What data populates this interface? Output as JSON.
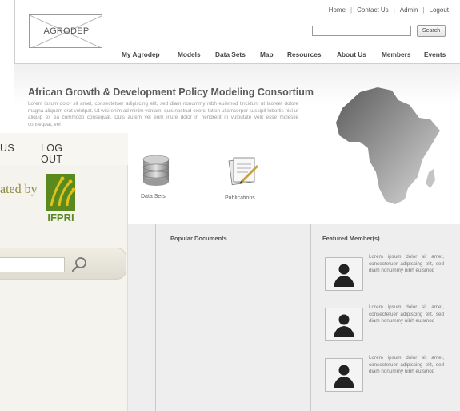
{
  "wire": {
    "logo_text": "AGRODEP",
    "top_links": [
      "Home",
      "Contact Us",
      "Admin",
      "Logout"
    ],
    "search_button": "Search",
    "nav": [
      "My Agrodep",
      "Models",
      "Data Sets",
      "Map",
      "Resources",
      "About Us",
      "Members",
      "Events"
    ],
    "hero_title": "African Growth & Development Policy Modeling Consortium",
    "hero_text": "Lorem ipsum dolor sit amet, consectetuer adipiscing elit, sed diam nonummy nibh euismod tincidunt ut laoreet dolore magna aliquam erat volutpat. Ut wisi enim ad minim veniam, quis nostrud exerci tation ullamcorper suscipit lobortis nisl ut aliquip ex ea commodo consequat. Duis autem vel eum iriure dolor in hendrerit in vulputate velit esse molestie consequat, vel",
    "features": [
      {
        "label": "Data Sets",
        "icon": "database-icon"
      },
      {
        "label": "Publications",
        "icon": "publications-icon"
      }
    ],
    "popular_title": "Popular Documents",
    "featured_title": "Featured Member(s)",
    "member_text": "Lorem ipsum dolor sit amet, consectetuer adipiscing elit, sed diam nonummy nibh euismod"
  },
  "overlay": {
    "nav_a": "US",
    "nav_b": "LOG OUT",
    "hosted": "ated by",
    "ifpri": "IFPRI",
    "search_icon": "magnifier-icon"
  },
  "colors": {
    "overlay_bg": "#f5f3ed",
    "ifpri_green": "#5a8a1e",
    "ifpri_yellow": "#e2c21a",
    "lower_bg": "#eeeeee"
  }
}
